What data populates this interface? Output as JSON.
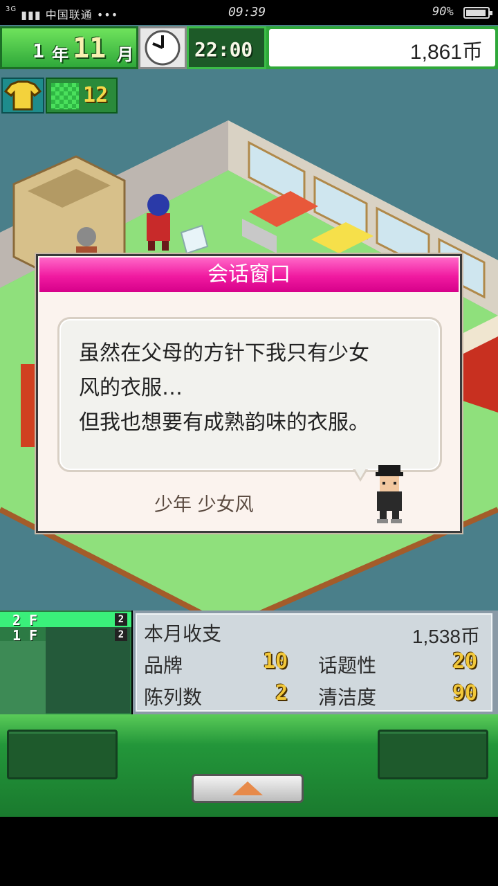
{
  "status_bar": {
    "network": "3G",
    "carrier": "中国联通 •••",
    "time": "09:39",
    "battery": "90%"
  },
  "hud": {
    "year_value": "1",
    "year_unit": "年",
    "month_value": "11",
    "month_unit": "月",
    "clock_time": "22:00",
    "money": "1,861币",
    "shirt_icon": "shirt-icon",
    "rank_count": "12"
  },
  "dialog": {
    "title": "会话窗口",
    "lines": [
      "虽然在父母的方针下我只有少女",
      "风的衣服…",
      "但我也想要有成熟韵味的衣服。"
    ],
    "speaker": "少年 少女风"
  },
  "floors": [
    {
      "label": "2 F",
      "count": "2"
    },
    {
      "label": "1 F",
      "count": "2"
    }
  ],
  "stats": {
    "monthly_label": "本月收支",
    "monthly_value": "1,538币",
    "brand_label": "品牌",
    "brand_value": "10",
    "topic_label": "话题性",
    "topic_value": "20",
    "display_label": "陈列数",
    "display_value": "2",
    "clean_label": "清洁度",
    "clean_value": "90"
  },
  "colors": {
    "title_bar": "#f01aa0",
    "hud_green": "#2fa83a",
    "gold_number": "#f2c83a"
  }
}
